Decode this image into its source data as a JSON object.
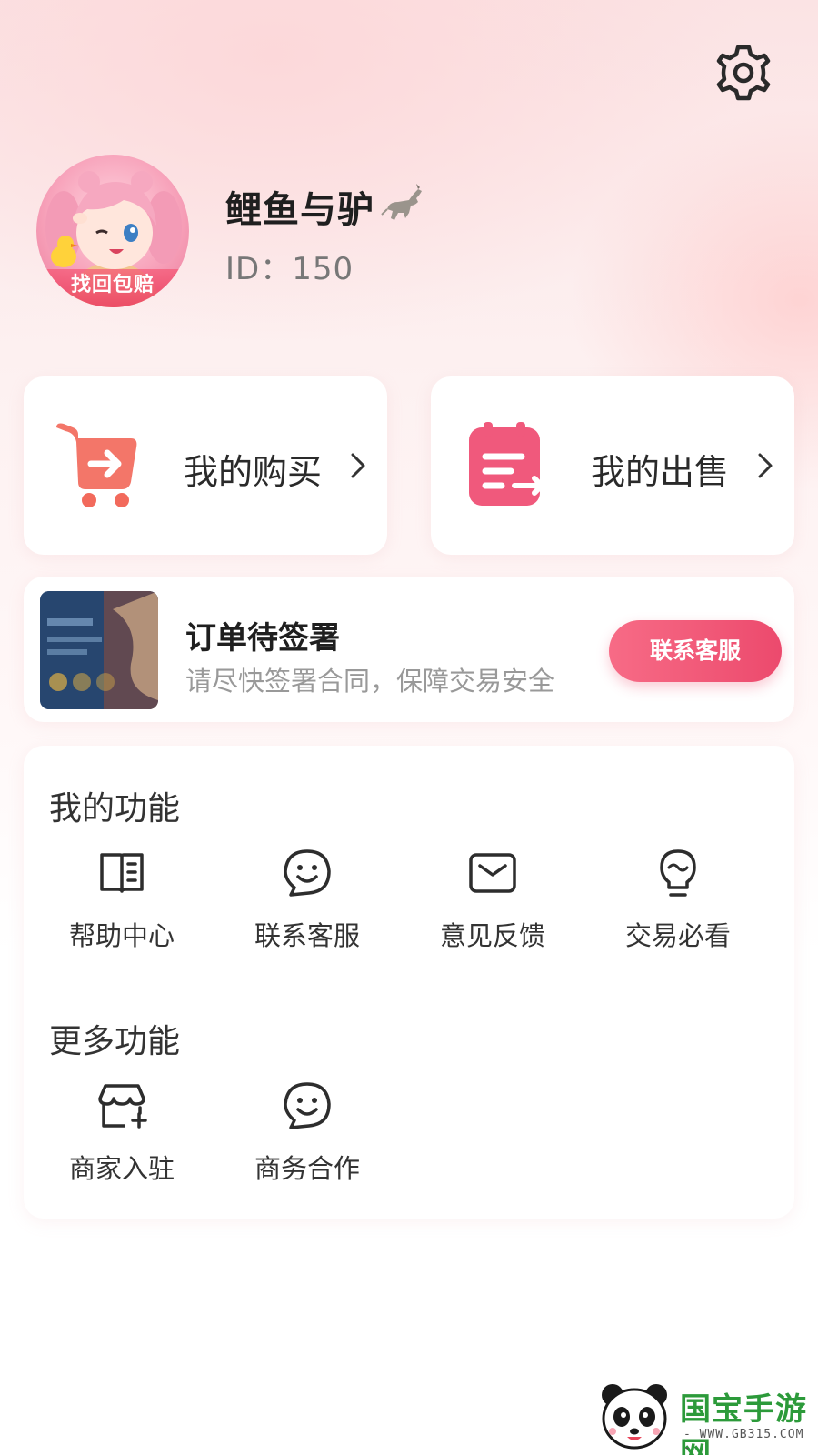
{
  "profile": {
    "username": "鲤鱼与驴",
    "id_text": "ID：150",
    "avatar_badge": "找回包赔"
  },
  "cards": {
    "buy_label": "我的购买",
    "sell_label": "我的出售"
  },
  "order": {
    "title": "订单待签署",
    "subtitle": "请尽快签署合同，保障交易安全",
    "button": "联系客服"
  },
  "my_functions": {
    "title": "我的功能",
    "items": [
      {
        "label": "帮助中心",
        "icon": "book-icon"
      },
      {
        "label": "联系客服",
        "icon": "smile-chat-icon"
      },
      {
        "label": "意见反馈",
        "icon": "mail-icon"
      },
      {
        "label": "交易必看",
        "icon": "lightbulb-icon"
      }
    ]
  },
  "more_functions": {
    "title": "更多功能",
    "items": [
      {
        "label": "商家入驻",
        "icon": "store-add-icon"
      },
      {
        "label": "商务合作",
        "icon": "smile-chat-icon"
      }
    ]
  },
  "watermark": {
    "text": "国宝手游网",
    "url": "- WWW.GB315.COM -"
  },
  "colors": {
    "accent": "#ec4a6d",
    "buy_icon": "#f26a5c",
    "sell_icon": "#f0597c"
  }
}
